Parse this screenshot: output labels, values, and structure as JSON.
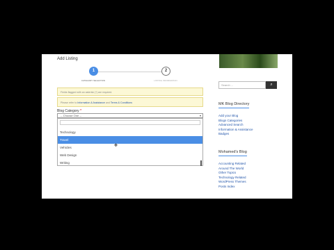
{
  "form": {
    "title": "Add Listing",
    "steps": [
      {
        "number": "1",
        "label": "CATEGORY SELECTION"
      },
      {
        "number": "2",
        "label": "LISTING INFORMATION"
      }
    ],
    "notice_1": "Fields flagged with an asterisk (*) are required.",
    "notice_2_prefix": "Please refer to",
    "notice_2_link1": "Information & Assistance",
    "notice_2_mid": "and",
    "notice_2_link2": "Terms & Conditions",
    "category_label": "Blog Category",
    "required_mark": "*",
    "select_value": "-- Choose One --",
    "options": [
      "Technology",
      "Travel",
      "Vehicles",
      "Web Design",
      "Writing"
    ],
    "selected_option": "Travel"
  },
  "sidebar": {
    "search_placeholder": "Search ...",
    "widget1_title": "MK Blog Directory",
    "widget1_links": [
      "Add your Blog",
      "Blogs Categories",
      "Advanced Search",
      "Information & Assistance",
      "Badges"
    ],
    "widget2_title": "Mohamed's Blog",
    "widget2_links": [
      "Accounting Related",
      "Around The World",
      "Other Topics",
      "Technology Related",
      "WordPress Themes",
      "Posts Index"
    ]
  },
  "colors": {
    "accent": "#4a8ee5",
    "notice_bg": "#fcf8d6",
    "link": "#2255aa"
  }
}
